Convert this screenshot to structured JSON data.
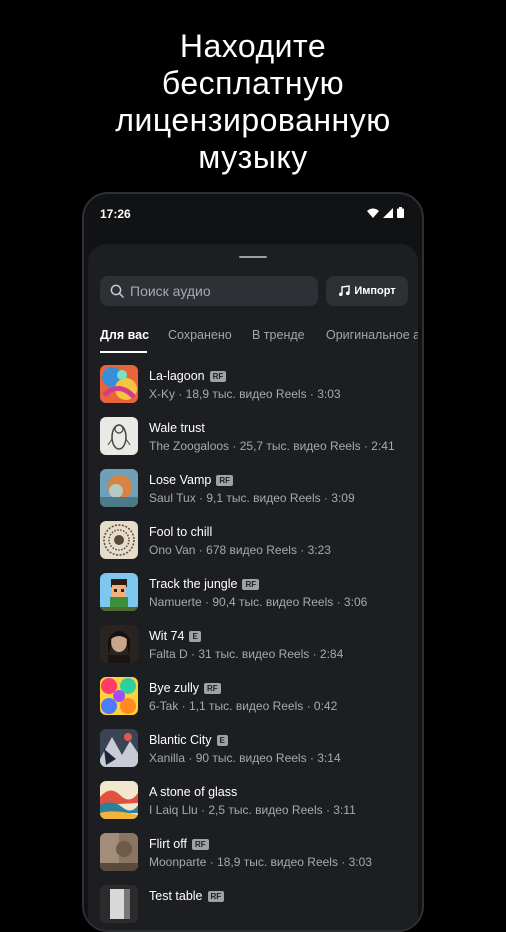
{
  "headline": [
    "Находите",
    "бесплатную",
    "лицензированную",
    "музыку"
  ],
  "status_bar": {
    "time": "17:26"
  },
  "search": {
    "placeholder": "Поиск аудио"
  },
  "import_button": {
    "label": "Импорт"
  },
  "tabs": [
    {
      "label": "Для вас",
      "active": true
    },
    {
      "label": "Сохранено",
      "active": false
    },
    {
      "label": "В тренде",
      "active": false
    },
    {
      "label": "Оригинальное а",
      "active": false
    }
  ],
  "tracks": [
    {
      "title": "La-lagoon",
      "badge": "RF",
      "meta": "X-Ky · 18,9 тыс. видео Reels · 3:03"
    },
    {
      "title": "Wale trust",
      "badge": "",
      "meta": "The Zoogaloos · 25,7 тыс. видео Reels · 2:41"
    },
    {
      "title": "Lose Vamp",
      "badge": "RF",
      "meta": "Saul Tux · 9,1 тыс. видео Reels · 3:09"
    },
    {
      "title": "Fool to chill",
      "badge": "",
      "meta": "Ono Van · 678 видео Reels · 3:23"
    },
    {
      "title": "Track the jungle",
      "badge": "RF",
      "meta": "Namuerte · 90,4 тыс. видео Reels · 3:06"
    },
    {
      "title": "Wit 74",
      "badge": "E",
      "meta": "Falta D · 31 тыс. видео Reels · 2:84"
    },
    {
      "title": "Bye zully",
      "badge": "RF",
      "meta": "6-Tak · 1,1 тыс. видео Reels · 0:42"
    },
    {
      "title": "Blantic City",
      "badge": "E",
      "meta": "Xanilla · 90 тыс. видео Reels · 3:14"
    },
    {
      "title": "A stone of glass",
      "badge": "",
      "meta": "I Laiq Llu · 2,5 тыс. видео Reels · 3:11"
    },
    {
      "title": "Flirt off",
      "badge": "RF",
      "meta": "Moonparte · 18,9 тыс. видео Reels · 3:03"
    },
    {
      "title": "Test table",
      "badge": "RF",
      "meta": ""
    }
  ],
  "icons": {
    "search": "search-icon",
    "import": "music-note-icon",
    "status": [
      "wifi-icon",
      "cellular-signal-icon",
      "battery-icon"
    ]
  }
}
